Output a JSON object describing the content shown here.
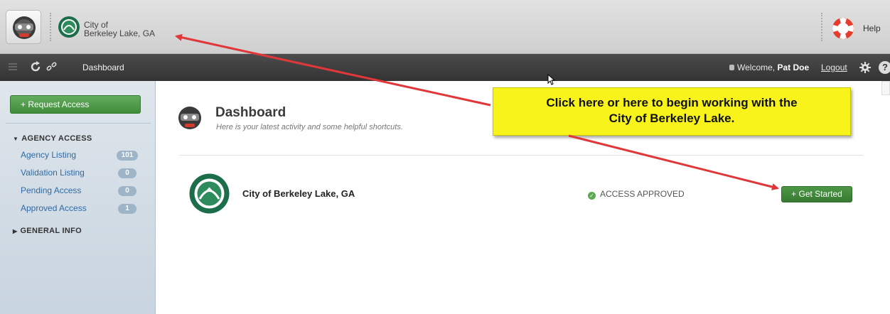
{
  "header": {
    "org_line1": "City of",
    "org_line2": "Berkeley Lake, GA",
    "help_label": "Help"
  },
  "navbar": {
    "title": "Dashboard",
    "welcome_prefix": "Welcome,",
    "user_name": "Pat Doe",
    "logout_label": "Logout"
  },
  "sidebar": {
    "request_access_label": "+ Request Access",
    "sections": [
      {
        "title": "AGENCY ACCESS",
        "expanded": true
      },
      {
        "title": "GENERAL INFO",
        "expanded": false
      }
    ],
    "items": [
      {
        "label": "Agency Listing",
        "count": "101"
      },
      {
        "label": "Validation Listing",
        "count": "0"
      },
      {
        "label": "Pending Access",
        "count": "0"
      },
      {
        "label": "Approved Access",
        "count": "1"
      }
    ]
  },
  "main": {
    "title": "Dashboard",
    "subtitle": "Here is your latest activity and some helpful shortcuts.",
    "agency": {
      "name": "City of Berkeley Lake, GA",
      "status": "ACCESS APPROVED",
      "action_label": "+ Get Started"
    }
  },
  "callout": {
    "line1": "Click here or here to begin working with the",
    "line2": "City of Berkeley Lake."
  },
  "colors": {
    "accent_green": "#4d9746",
    "callout_yellow": "#f7f31b",
    "arrow_red": "#e0373a",
    "link_blue": "#2f6aa5",
    "navbar_dark": "#3c3c3c"
  }
}
